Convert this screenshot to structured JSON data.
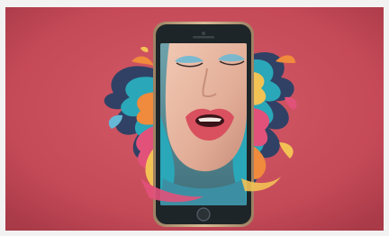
{
  "image": {
    "subject": "smartphone-with-face-and-color-splash",
    "colors": {
      "background": "#c54a58",
      "background_shadow": "#a93a48",
      "phone_frame": "#b99a7a",
      "phone_body": "#1e2528",
      "screen_bg": "#5a8f99",
      "skin": "#e9b9a4",
      "lips": "#d9505f",
      "eyeshadow": "#66b9d6",
      "splash_teal": "#2aa7b8",
      "splash_orange": "#f08a3c",
      "splash_yellow": "#f3c255",
      "splash_pink": "#e2517a",
      "splash_navy": "#1f3f66"
    }
  }
}
